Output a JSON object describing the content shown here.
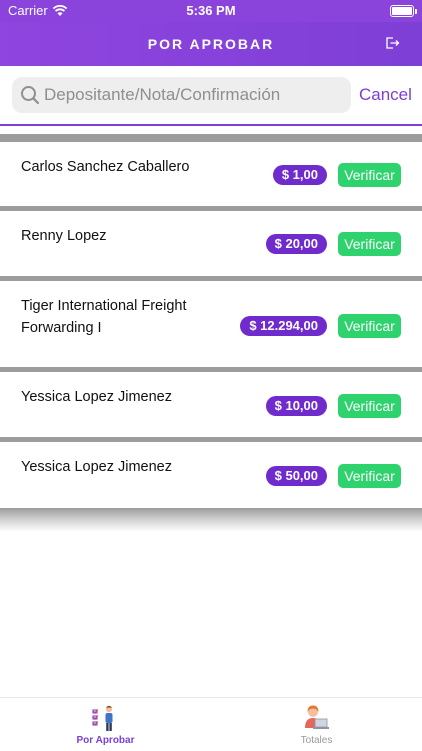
{
  "status_bar": {
    "carrier": "Carrier",
    "time": "5:36 PM"
  },
  "header": {
    "title": "POR APROBAR",
    "logout_icon": "logout-icon"
  },
  "search": {
    "placeholder": "Depositante/Nota/Confirmación",
    "value": "",
    "cancel_label": "Cancel"
  },
  "deposits": [
    {
      "name": "Carlos Sanchez Caballero",
      "amount": "$ 1,00",
      "action": "Verificar"
    },
    {
      "name": "Renny Lopez",
      "amount": "$ 20,00",
      "action": "Verificar"
    },
    {
      "name": "Tiger International Freight Forwarding I",
      "amount": "$ 12.294,00",
      "action": "Verificar"
    },
    {
      "name": "Yessica Lopez Jimenez",
      "amount": "$ 10,00",
      "action": "Verificar"
    },
    {
      "name": "Yessica Lopez Jimenez",
      "amount": "$ 50,00",
      "action": "Verificar"
    }
  ],
  "tabs": [
    {
      "label": "Por Aprobar",
      "icon": "checklist-person-icon",
      "active": true
    },
    {
      "label": "Totales",
      "icon": "person-laptop-icon",
      "active": false
    }
  ],
  "colors": {
    "primary": "#8a44dc",
    "amount_badge": "#6f2bcc",
    "verify_button": "#2fd36e"
  }
}
